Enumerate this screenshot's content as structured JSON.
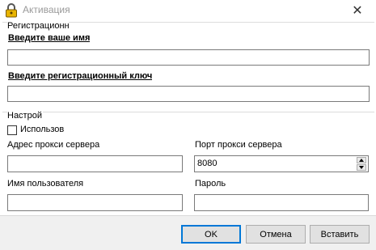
{
  "window": {
    "title": "Активация",
    "close_glyph": "✕"
  },
  "registration": {
    "group_label": "Регистрационн",
    "name_label": "Введите ваше имя",
    "name_value": "",
    "key_label": "Введите регистрационный ключ",
    "key_value": ""
  },
  "settings": {
    "group_label": "Настрой",
    "use_proxy_label": "Использов",
    "use_proxy_checked": false,
    "proxy_address_label": "Адрес прокси сервера",
    "proxy_address_value": "",
    "proxy_port_label": "Порт прокси сервера",
    "proxy_port_value": "8080",
    "username_label": "Имя пользователя",
    "username_value": "",
    "password_label": "Пароль",
    "password_value": ""
  },
  "buttons": {
    "ok": "OK",
    "cancel": "Отмена",
    "paste": "Вставить"
  },
  "colors": {
    "accent": "#0078d7",
    "title_inactive": "#999999",
    "footer_bg": "#f0f0f0"
  },
  "icons": {
    "app": "lock-icon",
    "close": "close-icon"
  }
}
